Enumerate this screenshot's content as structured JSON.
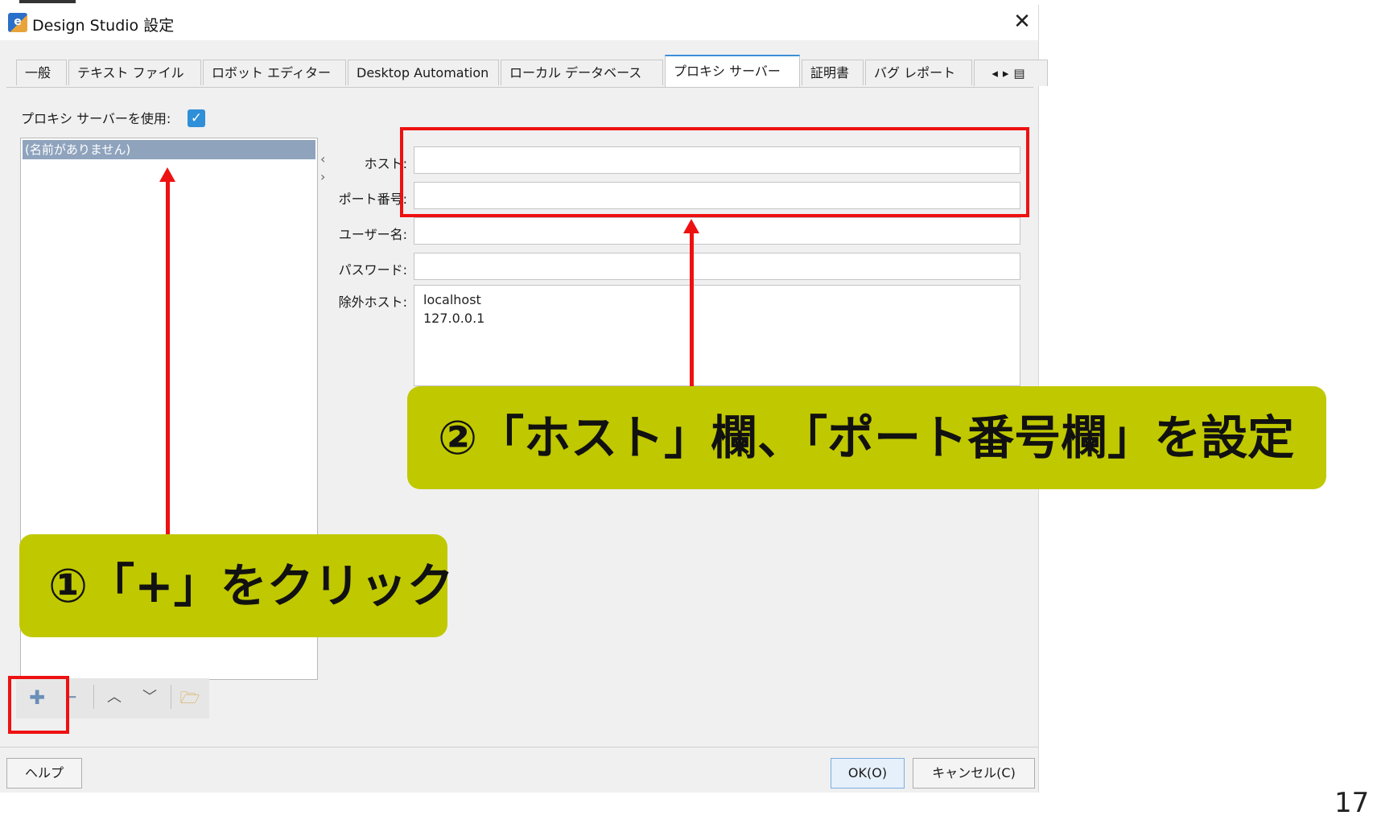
{
  "window": {
    "title": "Design Studio 設定",
    "close_glyph": "✕",
    "app_icon_glyph": "e"
  },
  "tabs": [
    {
      "label": "一般"
    },
    {
      "label": "テキスト ファイル"
    },
    {
      "label": "ロボット エディター"
    },
    {
      "label": "Desktop Automation"
    },
    {
      "label": "ローカル データベース"
    },
    {
      "label": "プロキシ サーバー",
      "active": true
    },
    {
      "label": "証明書"
    },
    {
      "label": "バグ レポート"
    }
  ],
  "tab_nav_glyphs": "◂▸▤",
  "proxy": {
    "use_proxy_label": "プロキシ サーバーを使用:",
    "use_proxy_checked": true,
    "check_glyph": "✓",
    "list": [
      "(名前がありません)"
    ],
    "splitter_left": "‹",
    "splitter_right": "›"
  },
  "form": {
    "host_label": "ホスト:",
    "host_value": "",
    "port_label": "ポート番号:",
    "port_value": "",
    "user_label": "ユーザー名:",
    "user_value": "",
    "password_label": "パスワード:",
    "password_value": "",
    "exclude_label": "除外ホスト:",
    "exclude_hosts": [
      "localhost",
      "127.0.0.1"
    ]
  },
  "list_toolbar": {
    "add_icon": "plus-icon",
    "add_glyph": "✚",
    "remove_icon": "minus-icon",
    "remove_glyph": "━",
    "up_icon": "chevron-up-icon",
    "up_glyph": "︿",
    "down_icon": "chevron-down-icon",
    "down_glyph": "﹀",
    "folder_icon": "folder-icon",
    "folder_glyph": "🗁"
  },
  "buttons": {
    "help": "ヘルプ",
    "ok": "OK(O)",
    "cancel": "キャンセル(C)"
  },
  "annotations": {
    "callout_1": "①「+」をクリック",
    "callout_2": "②「ホスト」欄、「ポート番号欄」を設定",
    "highlight_color": "#ee1111",
    "callout_color": "#c0c800"
  },
  "page_number": "17"
}
